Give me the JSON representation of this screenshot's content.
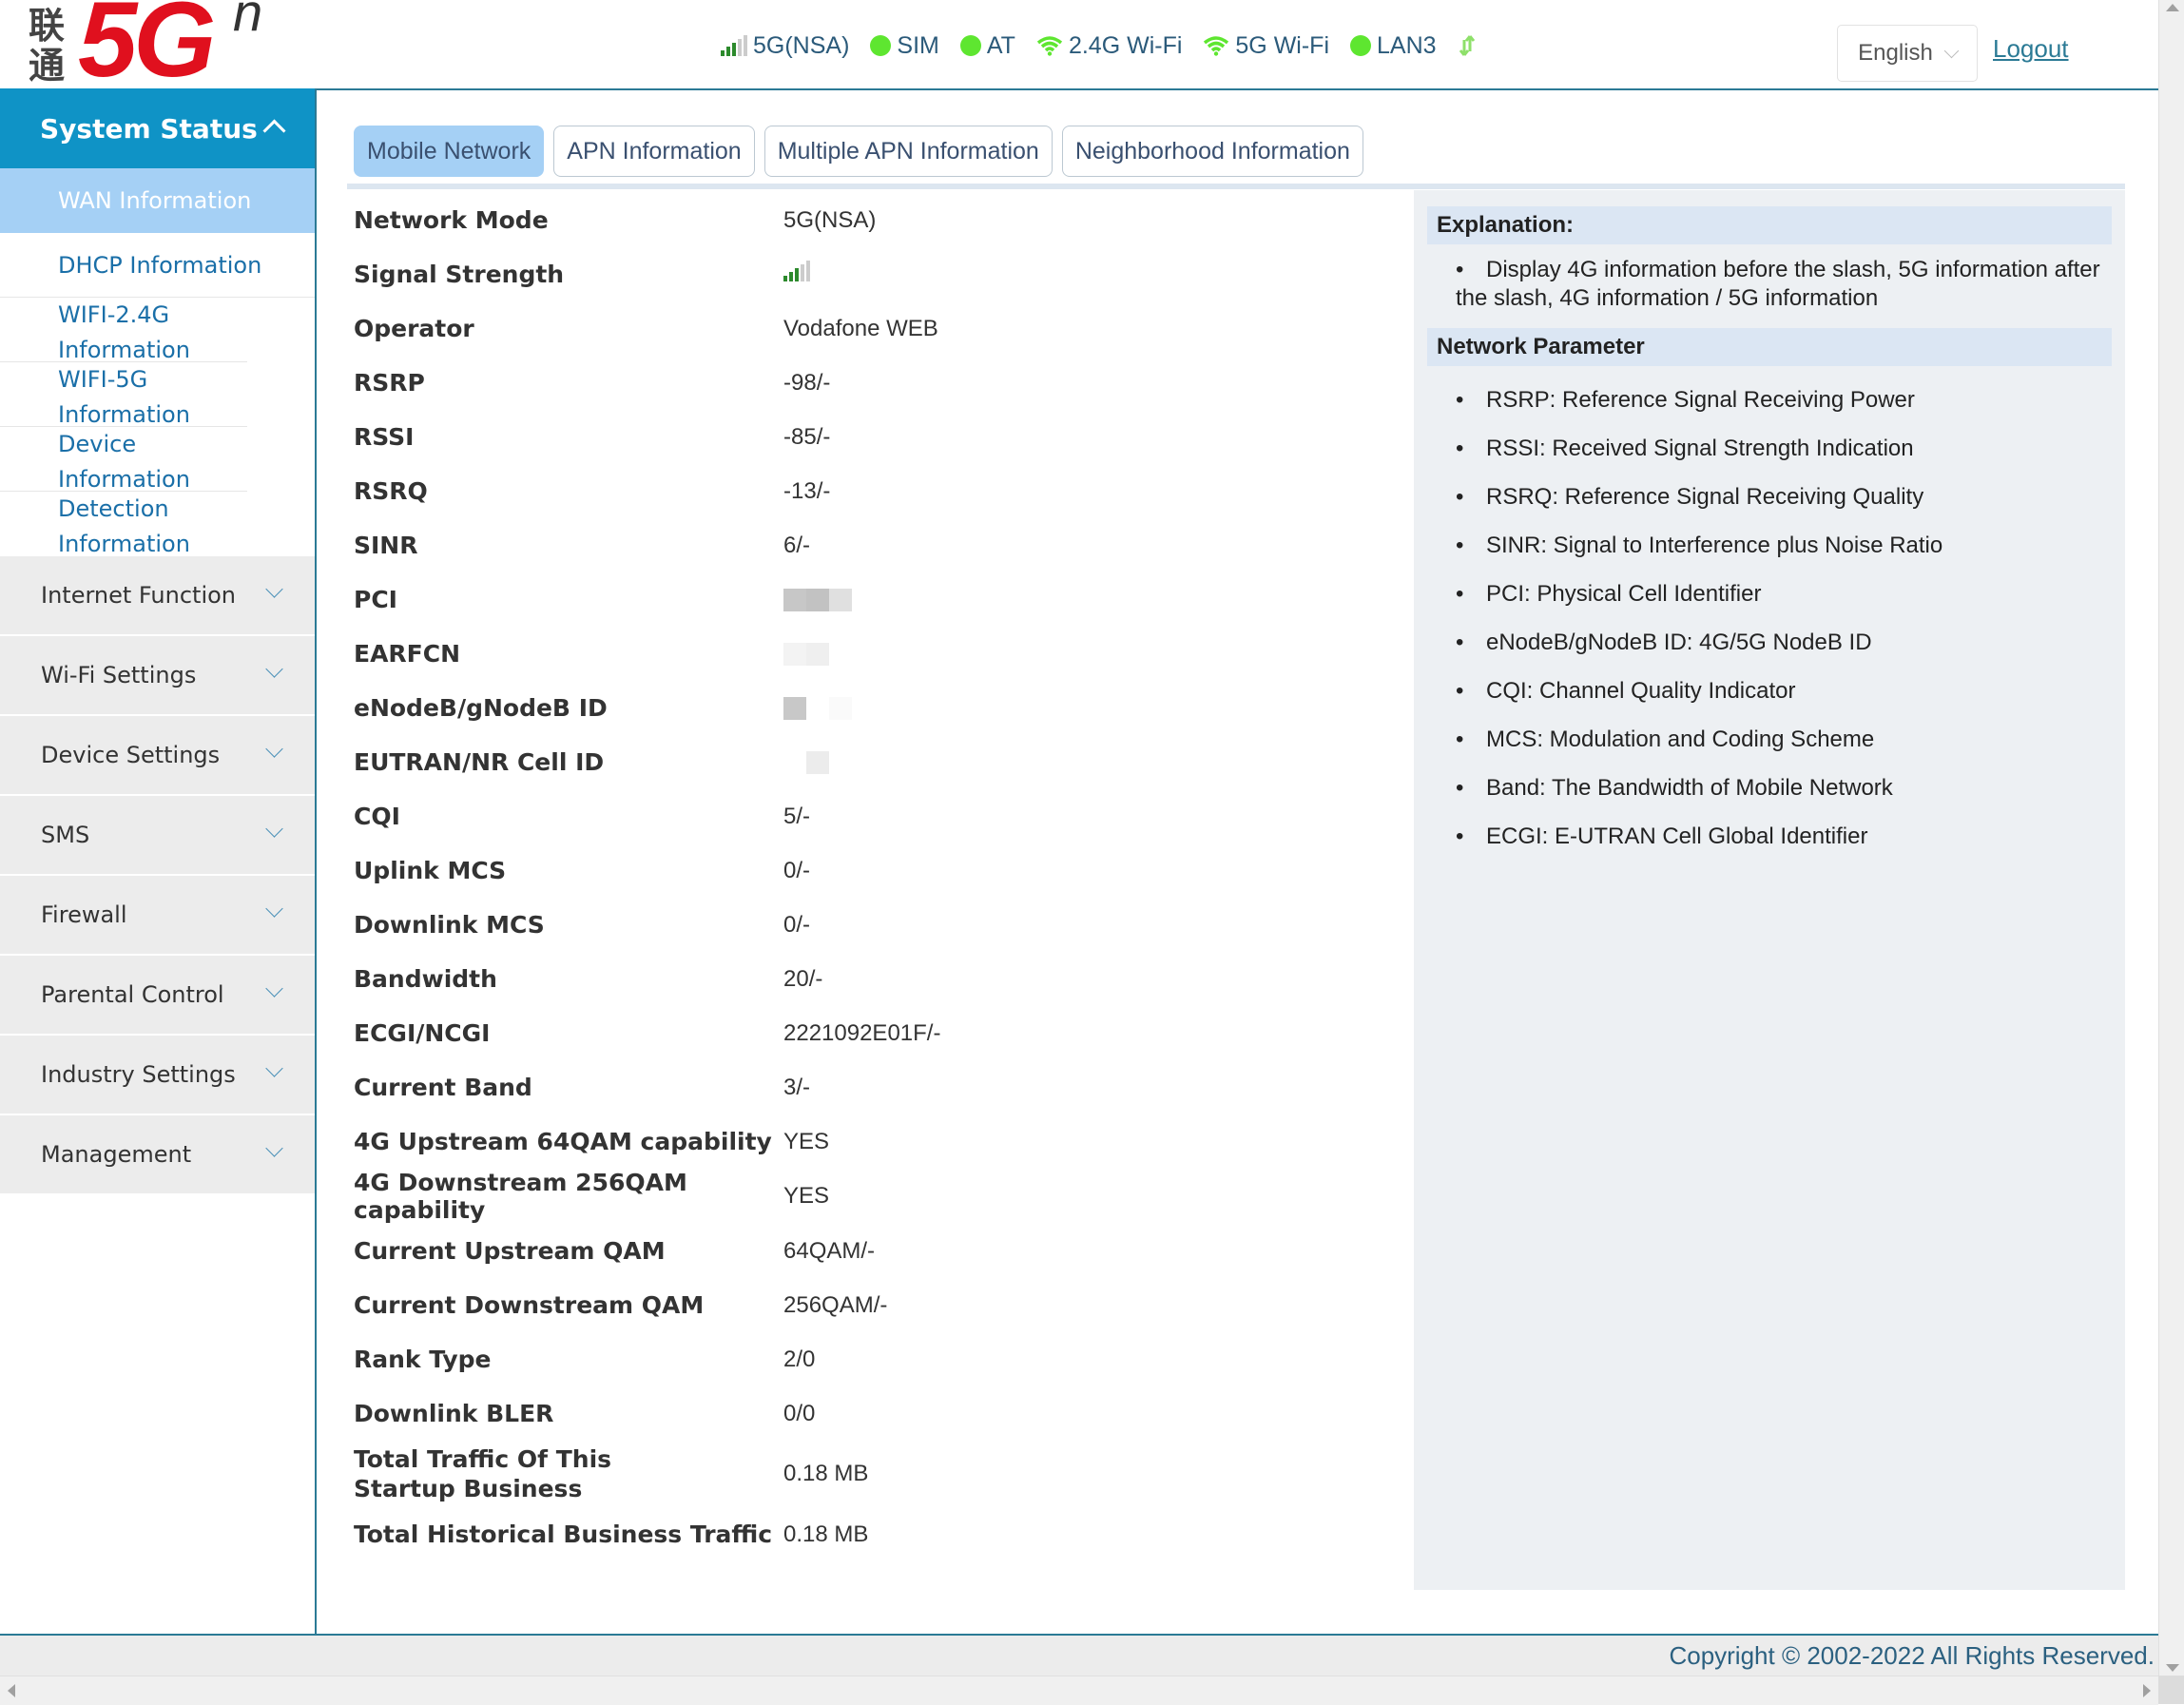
{
  "header": {
    "logo": {
      "cn_text": "联通",
      "brand": "5G",
      "superscript": "n",
      "brand_color": "#e0101e"
    },
    "status_items": [
      {
        "icon": "signal-bars-icon",
        "label": "5G(NSA)",
        "signal_level": 3,
        "signal_max": 5
      },
      {
        "icon": "status-dot-icon",
        "label": "SIM",
        "color": "#5ee630"
      },
      {
        "icon": "status-dot-icon",
        "label": "AT",
        "color": "#5ee630"
      },
      {
        "icon": "wifi-icon",
        "label": "2.4G Wi-Fi",
        "color": "#5ee630"
      },
      {
        "icon": "wifi-icon",
        "label": "5G Wi-Fi",
        "color": "#5ee630"
      },
      {
        "icon": "status-dot-icon",
        "label": "LAN3",
        "color": "#5ee630"
      },
      {
        "icon": "data-transfer-icon",
        "label": "",
        "color": "#8ee06a"
      }
    ],
    "language": "English",
    "logout": "Logout"
  },
  "sidebar": {
    "active_group": "System Status",
    "system_status_items": [
      {
        "label": "WAN Information",
        "active": true
      },
      {
        "label": "DHCP Information",
        "active": false
      },
      {
        "label": "WIFI-2.4G Information",
        "active": false
      },
      {
        "label": "WIFI-5G Information",
        "active": false
      },
      {
        "label": "Device Information",
        "active": false
      },
      {
        "label": "Detection Information",
        "active": false
      }
    ],
    "groups": [
      "Internet Function",
      "Wi-Fi Settings",
      "Device Settings",
      "SMS",
      "Firewall",
      "Parental Control",
      "Industry Settings",
      "Management"
    ]
  },
  "tabs": [
    {
      "label": "Mobile Network",
      "active": true
    },
    {
      "label": "APN Information",
      "active": false
    },
    {
      "label": "Multiple APN Information",
      "active": false
    },
    {
      "label": "Neighborhood Information",
      "active": false
    }
  ],
  "mobile_network": {
    "rows": [
      {
        "label": "Network Mode",
        "value": "5G(NSA)"
      },
      {
        "label": "Signal Strength",
        "value": "",
        "signal_level": 3,
        "signal_max": 5
      },
      {
        "label": "Operator",
        "value": "Vodafone WEB"
      },
      {
        "label": "RSRP",
        "value": "-98/-"
      },
      {
        "label": "RSSI",
        "value": "-85/-"
      },
      {
        "label": "RSRQ",
        "value": "-13/-"
      },
      {
        "label": "SINR",
        "value": "6/-"
      },
      {
        "label": "PCI",
        "value": "",
        "redacted": true
      },
      {
        "label": "EARFCN",
        "value": "",
        "redacted": true
      },
      {
        "label": "eNodeB/gNodeB ID",
        "value": "",
        "redacted": true
      },
      {
        "label": "EUTRAN/NR Cell ID",
        "value": "",
        "redacted": true
      },
      {
        "label": "CQI",
        "value": "5/-"
      },
      {
        "label": "Uplink MCS",
        "value": "0/-"
      },
      {
        "label": "Downlink MCS",
        "value": "0/-"
      },
      {
        "label": "Bandwidth",
        "value": "20/-"
      },
      {
        "label": "ECGI/NCGI",
        "value": "2221092E01F/-"
      },
      {
        "label": "Current Band",
        "value": "3/-"
      },
      {
        "label": "4G Upstream 64QAM capability",
        "value": "YES"
      },
      {
        "label": "4G Downstream 256QAM capability",
        "value": "YES"
      },
      {
        "label": "Current Upstream QAM",
        "value": "64QAM/-"
      },
      {
        "label": "Current Downstream QAM",
        "value": "256QAM/-"
      },
      {
        "label": "Rank Type",
        "value": "2/0"
      },
      {
        "label": "Downlink BLER",
        "value": "0/0"
      },
      {
        "label": "Total Traffic Of This Startup Business",
        "value": "0.18 MB"
      },
      {
        "label": "Total Historical Business Traffic",
        "value": "0.18 MB"
      }
    ]
  },
  "explanation": {
    "title": "Explanation:",
    "text": "Display 4G information before the slash, 5G information after the slash, 4G information / 5G information",
    "param_title": "Network Parameter",
    "params": [
      "RSRP: Reference Signal Receiving Power",
      "RSSI: Received Signal Strength Indication",
      "RSRQ: Reference Signal Receiving Quality",
      "SINR: Signal to Interference plus Noise Ratio",
      "PCI: Physical Cell Identifier",
      "eNodeB/gNodeB ID: 4G/5G NodeB ID",
      "CQI: Channel Quality Indicator",
      "MCS: Modulation and Coding Scheme",
      "Band: The Bandwidth of Mobile Network",
      "ECGI: E-UTRAN Cell Global Identifier"
    ]
  },
  "footer": {
    "copyright": "Copyright © 2002-2022 All Rights Reserved."
  }
}
